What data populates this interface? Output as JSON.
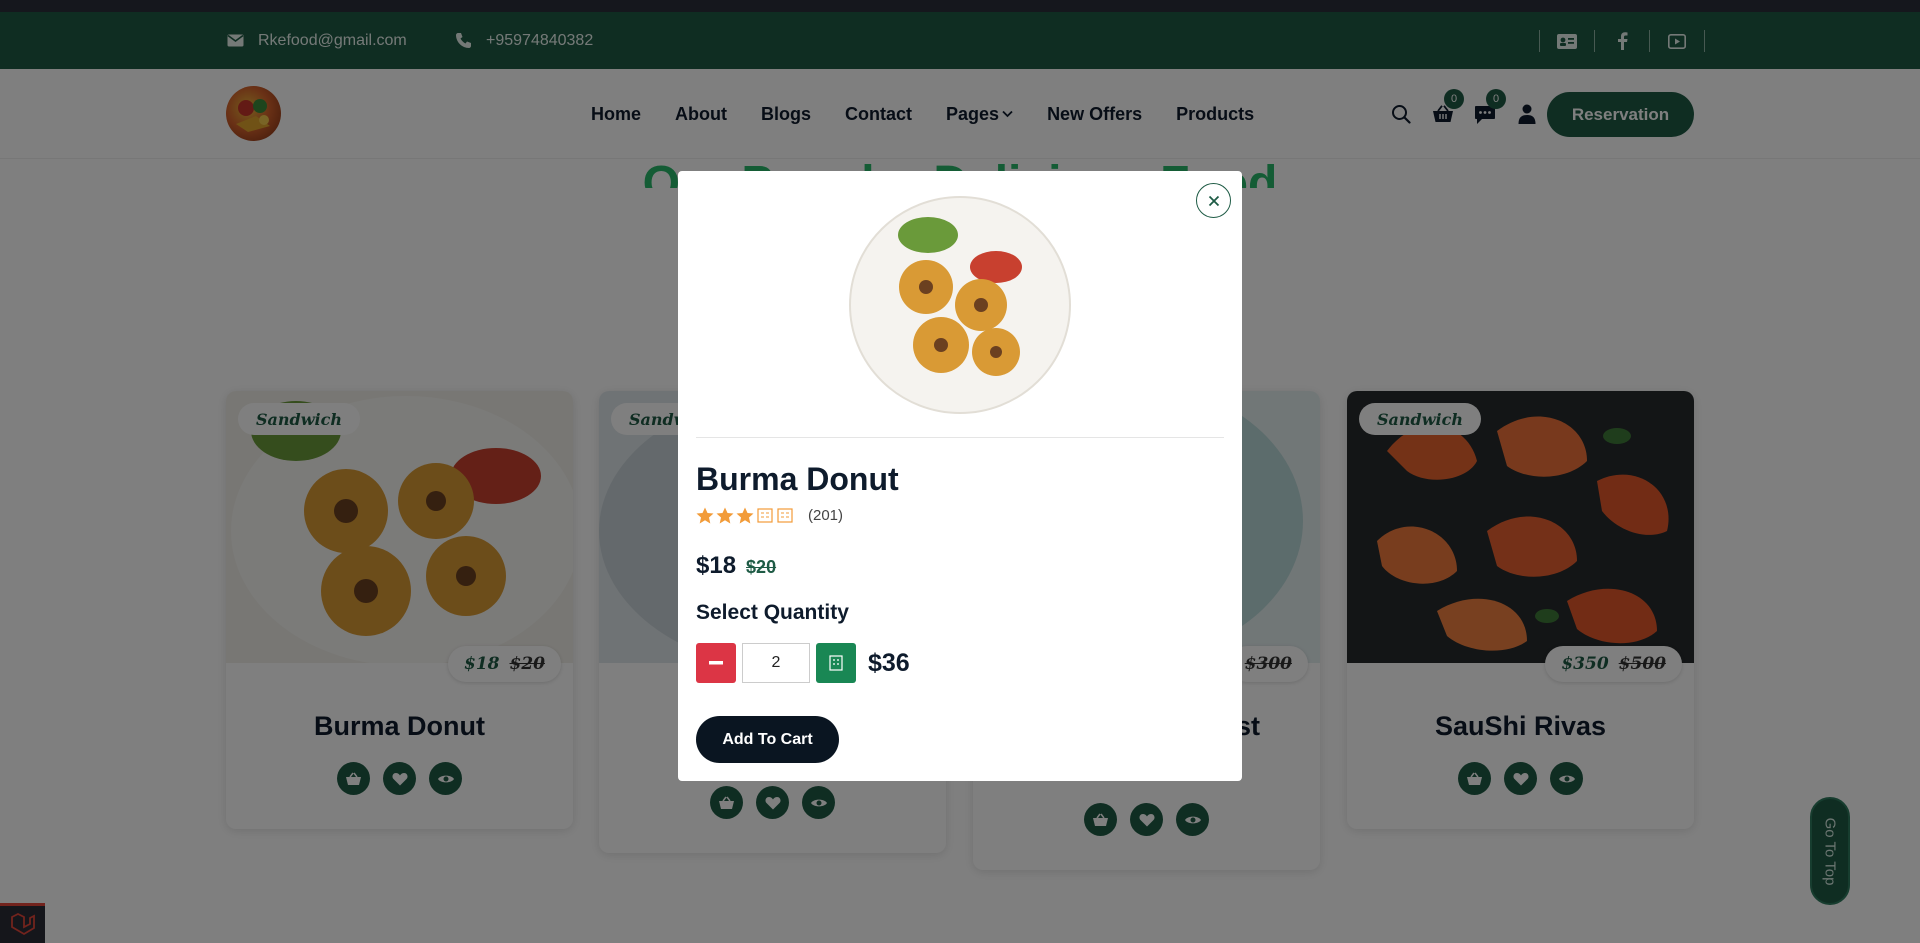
{
  "topbar": {
    "email": "Rkefood@gmail.com",
    "phone": "+95974840382",
    "social_icons": [
      "contact-card-icon",
      "facebook-icon",
      "youtube-icon"
    ]
  },
  "nav": {
    "links": [
      "Home",
      "About",
      "Blogs",
      "Contact",
      "Pages",
      "New Offers",
      "Products"
    ],
    "cart_count": "0",
    "message_count": "0",
    "reservation_label": "Reservation"
  },
  "section": {
    "title": "Our Popular Delicious Food"
  },
  "cards": [
    {
      "tag": "Sandwich",
      "price": "$18",
      "old_price": "$20",
      "name": "Burma Donut"
    },
    {
      "tag": "Sandwich"
    },
    {
      "old_price": "$300",
      "name_fragment": "st"
    },
    {
      "tag": "Sandwich",
      "price": "$350",
      "old_price": "$500",
      "name": "SauShi Rivas"
    }
  ],
  "modal": {
    "title": "Burma Donut",
    "rating_filled": 3,
    "rating_total": 5,
    "review_count": "(201)",
    "price": "$18",
    "old_price": "$20",
    "quantity_label": "Select Quantity",
    "quantity": "2",
    "total": "$36",
    "add_to_cart_label": "Add To Cart"
  },
  "go_top_label": "Go To Top",
  "colors": {
    "brand_green": "#1e5b45",
    "accent_green": "#28b86a",
    "minus_red": "#dc3545",
    "plus_green": "#198754",
    "star_orange": "#f29b38"
  }
}
